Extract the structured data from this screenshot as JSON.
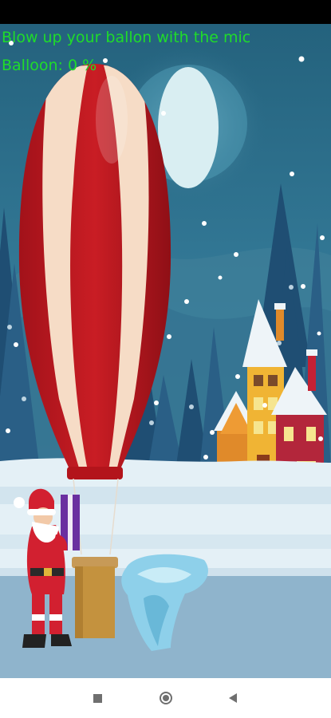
{
  "hud": {
    "instruction": "Blow up your ballon with the mic",
    "balloon_text": "Balloon: 0 %"
  },
  "balloon_level": 0,
  "colors": {
    "hud_text": "#1fdc2a",
    "sky": "#2a6f8c",
    "moon": "#d9eef2",
    "balloon_red": "#b3141b",
    "balloon_cream": "#f6dcc6",
    "snow": "#e4f0f6",
    "ice": "#8ed0ea"
  },
  "navigation": {
    "recents": "square-icon",
    "home": "circle-icon",
    "back": "triangle-back-icon"
  }
}
